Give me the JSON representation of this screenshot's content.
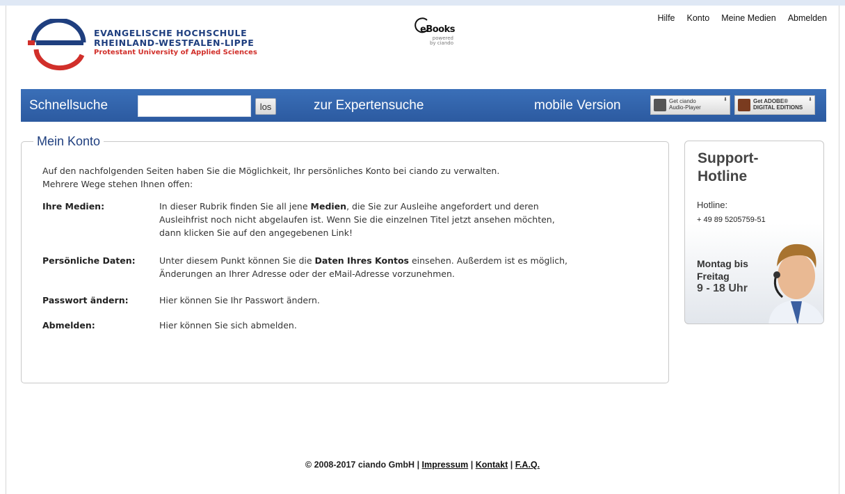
{
  "branding": {
    "logo_line1": "EVANGELISCHE HOCHSCHULE",
    "logo_line2": "RHEINLAND-WESTFALEN-LIPPE",
    "logo_line3": "Protestant University of Applied Sciences",
    "ebooks_title": "eBooks",
    "ebooks_sub1": "powered",
    "ebooks_sub2": "by ciando"
  },
  "topnav": [
    {
      "label": "Hilfe"
    },
    {
      "label": "Konto"
    },
    {
      "label": "Meine Medien"
    },
    {
      "label": "Abmelden"
    }
  ],
  "searchbar": {
    "label": "Schnellsuche",
    "input_value": "",
    "button": "los",
    "expert_link": "zur Expertensuche",
    "mobile_link": "mobile Version",
    "badge1_line1": "Get ciando",
    "badge1_line2": "Audio-Player",
    "badge2_line1": "Get ADOBE®",
    "badge2_line2": "DIGITAL EDITIONS"
  },
  "main": {
    "title": "Mein Konto",
    "intro_line1": "Auf den nachfolgenden Seiten haben Sie die Möglichkeit, Ihr persönliches Konto bei ciando zu verwalten.",
    "intro_line2": "Mehrere Wege stehen Ihnen offen:",
    "rows": [
      {
        "label": "Ihre Medien:",
        "line1_a": "In dieser Rubrik finden Sie all jene ",
        "line1_b": "Medien",
        "line1_c": ", die Sie zur Ausleihe angefordert und deren",
        "line2": "Ausleihfrist noch nicht abgelaufen ist. Wenn Sie die einzelnen Titel jetzt ansehen möchten,",
        "line3": "dann klicken Sie auf den angegebenen Link!"
      },
      {
        "label": "Persönliche Daten:",
        "line1_a": "Unter diesem Punkt können Sie die ",
        "line1_b": "Daten Ihres Kontos",
        "line1_c": " einsehen. Außerdem ist es möglich,",
        "line2": "Änderungen an Ihrer Adresse oder der eMail-Adresse vorzunehmen."
      },
      {
        "label": "Passwort ändern:",
        "line1": "Hier können Sie Ihr Passwort ändern."
      },
      {
        "label": "Abmelden:",
        "line1": "Hier können Sie sich abmelden."
      }
    ]
  },
  "support": {
    "title_line1": "Support-",
    "title_line2": "Hotline",
    "hotline_label": "Hotline:",
    "hotline_number": "+ 49 89 5205759-51",
    "hours_line1": "Montag bis",
    "hours_line2": "Freitag",
    "hours_line3": "9 - 18 Uhr"
  },
  "footer": {
    "copyright": "© 2008-2017 ciando GmbH",
    "sep": " | ",
    "impressum": "Impressum",
    "kontakt": "Kontakt",
    "faq": "F.A.Q."
  },
  "colors": {
    "brand_blue": "#1f3f7f",
    "brand_red": "#d12f2a",
    "bar_blue": "#2f60a8"
  }
}
